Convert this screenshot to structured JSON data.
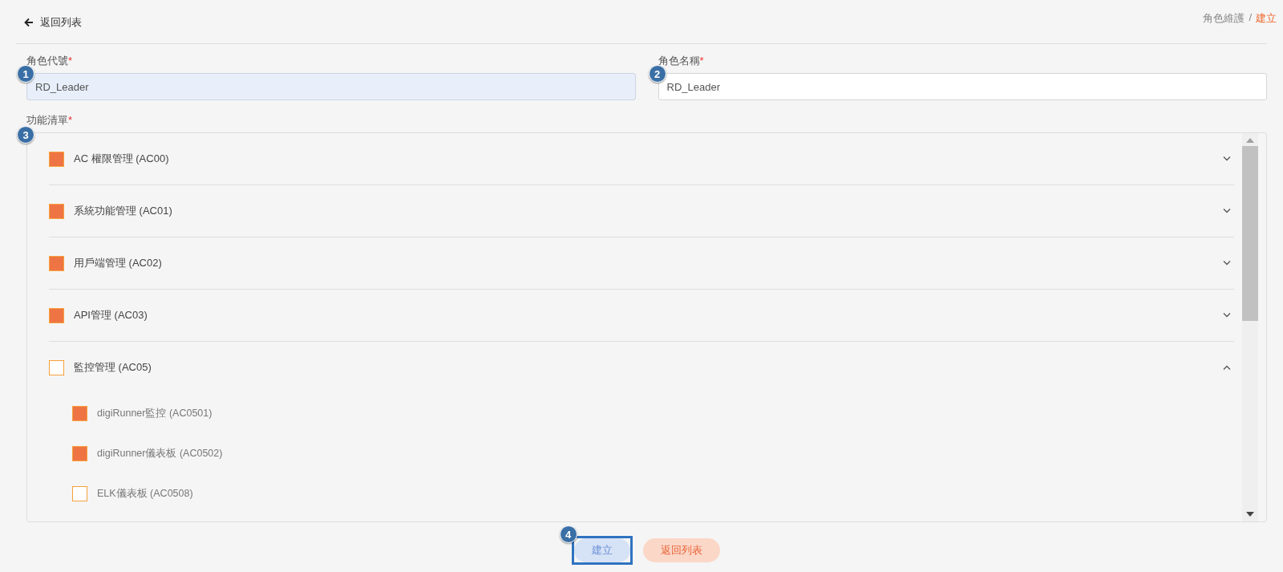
{
  "header": {
    "back_link": "返回列表",
    "breadcrumb_separator": "/",
    "breadcrumb": [
      {
        "label": "角色維護",
        "selected": false
      },
      {
        "label": "建立",
        "selected": true
      }
    ]
  },
  "fields": [
    {
      "label": "角色代號",
      "required": "*",
      "badge": "1",
      "value": "RD_Leader",
      "kind": "locked"
    },
    {
      "label": "角色名稱",
      "required": "*",
      "badge": "2",
      "value": "RD_Leader",
      "kind": "editable"
    }
  ],
  "function_list": {
    "label": "功能清單",
    "required": "*",
    "badge": "3",
    "items": [
      {
        "label": "AC 權限管理 (AC00)",
        "checked": true,
        "expanded": false
      },
      {
        "label": "系統功能管理 (AC01)",
        "checked": true,
        "expanded": false
      },
      {
        "label": "用戶端管理 (AC02)",
        "checked": true,
        "expanded": false
      },
      {
        "label": "API管理 (AC03)",
        "checked": true,
        "expanded": false
      },
      {
        "label": "監控管理 (AC05)",
        "checked": false,
        "expanded": true,
        "children": [
          {
            "label": "digiRunner監控 (AC0501)",
            "checked": true
          },
          {
            "label": "digiRunner儀表板 (AC0502)",
            "checked": true
          },
          {
            "label": "ELK儀表板 (AC0508)",
            "checked": false
          }
        ]
      }
    ]
  },
  "buttons": [
    {
      "label": "建立",
      "kind": "primary",
      "badge": "4"
    },
    {
      "label": "返回列表",
      "kind": "secondary"
    }
  ]
}
